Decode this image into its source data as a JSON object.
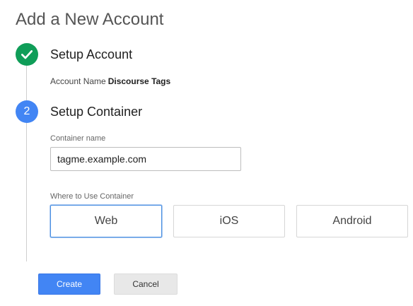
{
  "page": {
    "title": "Add a New Account"
  },
  "steps": [
    {
      "number": "1",
      "icon": "check-icon",
      "title": "Setup Account",
      "status_color": "#0f9d58"
    },
    {
      "number": "2",
      "title": "Setup Container",
      "status_color": "#4285f4"
    }
  ],
  "account": {
    "label": "Account Name",
    "value": "Discourse Tags"
  },
  "container": {
    "name_label": "Container name",
    "name_value": "tagme.example.com",
    "where_label": "Where to Use Container",
    "platforms": [
      {
        "label": "Web",
        "selected": true
      },
      {
        "label": "iOS",
        "selected": false
      },
      {
        "label": "Android",
        "selected": false
      }
    ]
  },
  "actions": {
    "create_label": "Create",
    "cancel_label": "Cancel"
  },
  "colors": {
    "primary": "#4285f4",
    "success": "#0f9d58",
    "selected_border": "#4a90e2"
  }
}
